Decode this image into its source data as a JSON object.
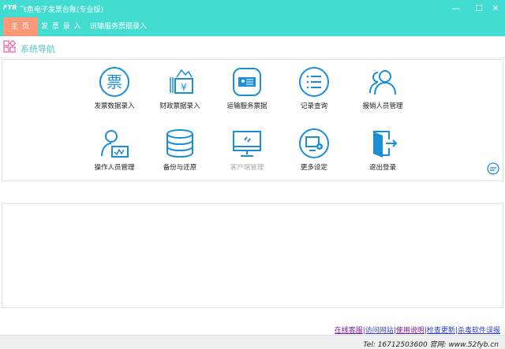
{
  "window": {
    "logo": "FYB",
    "title": "飞鱼电子发票台账(专业版)",
    "minimize": "—",
    "maximize": "☐",
    "close": "✕"
  },
  "tabs": [
    {
      "label": "主 页"
    },
    {
      "label": "发 票 录 入"
    },
    {
      "label": "运输服务票据录入"
    }
  ],
  "nav": {
    "title": "系统导航"
  },
  "items": [
    {
      "label": "发票数据录入",
      "icon": "invoice-icon"
    },
    {
      "label": "财政票据录入",
      "icon": "fiscal-receipt-icon"
    },
    {
      "label": "运输服务票据",
      "icon": "transport-ticket-icon"
    },
    {
      "label": "记录查询",
      "icon": "list-icon"
    },
    {
      "label": "报销人员管理",
      "icon": "users-icon"
    },
    {
      "label": "操作人员管理",
      "icon": "operator-icon"
    },
    {
      "label": "备份与还原",
      "icon": "database-icon"
    },
    {
      "label": "客户端管理",
      "icon": "monitor-icon"
    },
    {
      "label": "更多设定",
      "icon": "settings-icon"
    },
    {
      "label": "退出登录",
      "icon": "logout-icon"
    }
  ],
  "links": [
    "在线客服",
    "访问网站",
    "使用说明",
    "检查更新",
    "杀毒软件误报"
  ],
  "status": "Tel: 16712503600  官网: www.52fyb.cn",
  "colors": {
    "accent": "#42ddd0",
    "active_tab": "#f8997a",
    "icon": "#1a8fd8"
  }
}
